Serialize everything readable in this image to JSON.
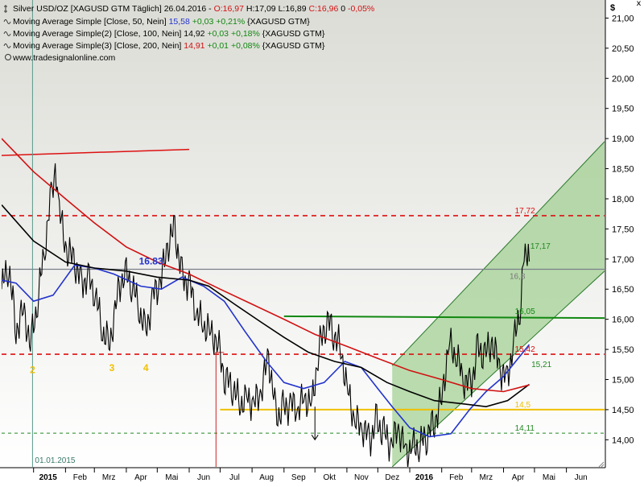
{
  "header": {
    "instrument_name": "Silver USD/OZ [XAGUSD GTM  Täglich]",
    "date": "26.04.2016",
    "ohlc": {
      "open": "O:16,97",
      "high": "H:17,09",
      "low": "L:16,89",
      "close": "C:16,96",
      "change": "0",
      "change_pct": "-0,05%"
    },
    "studies": [
      {
        "name": "Moving Average Simple [Close, 50, Nein]",
        "value": "15,58",
        "change": "+0,03",
        "change_pct": "+0,21%",
        "symbol": "{XAGUSD GTM}",
        "color": "#2233cc"
      },
      {
        "name": "Moving Average Simple(2) [Close, 100, Nein]",
        "value": "14,92",
        "change": "+0,03",
        "change_pct": "+0,18%",
        "symbol": "{XAGUSD GTM}",
        "color": "#000000"
      },
      {
        "name": "Moving Average Simple(3) [Close, 200, Nein]",
        "value": "14,91",
        "change": "+0,01",
        "change_pct": "+0,08%",
        "symbol": "{XAGUSD GTM}",
        "color": "#d11111"
      }
    ],
    "website": "www.tradesignalonline.com",
    "close_glyph": "x"
  },
  "colors": {
    "background_top": "#dcdcd6",
    "background_bottom": "#ffffff",
    "price": "#000000",
    "sma50": "#2233cc",
    "sma100": "#000000",
    "sma200": "#d11111",
    "resistance_dash": "#dd1111",
    "support_green_dash": "#228822",
    "yellow_line": "#f0c000",
    "green_line": "#118811",
    "channel_fill": "#9ecf8e",
    "channel_line": "#2a7a2a",
    "wave_label": "#f0c000",
    "blue_text": "#2233cc",
    "red_vertical": "#cc2222"
  },
  "chart_data": {
    "type": "line",
    "title": "Silver USD/OZ [XAGUSD GTM  Täglich]",
    "currency_label": "$",
    "ylim": [
      13.55,
      21.3
    ],
    "y_ticks": [
      "21,00",
      "20,50",
      "20,00",
      "19,50",
      "19,00",
      "18,50",
      "18,00",
      "17,50",
      "17,00",
      "16,50",
      "16,00",
      "15,50",
      "15,00",
      "14,50",
      "14,00"
    ],
    "y_tick_values": [
      21.0,
      20.5,
      20.0,
      19.5,
      19.0,
      18.5,
      18.0,
      17.5,
      17.0,
      16.5,
      16.0,
      15.5,
      15.0,
      14.5,
      14.0
    ],
    "x_date_range": [
      "2014-12-01",
      "2016-07-08"
    ],
    "month_labels": [
      {
        "date": "2015-01-01",
        "label": "2015",
        "bold": true
      },
      {
        "date": "2015-02-01",
        "label": "Feb"
      },
      {
        "date": "2015-03-01",
        "label": "Mrz"
      },
      {
        "date": "2015-04-01",
        "label": "Apr"
      },
      {
        "date": "2015-05-01",
        "label": "Mai"
      },
      {
        "date": "2015-06-01",
        "label": "Jun"
      },
      {
        "date": "2015-07-01",
        "label": "Jul"
      },
      {
        "date": "2015-08-01",
        "label": "Aug"
      },
      {
        "date": "2015-09-01",
        "label": "Sep"
      },
      {
        "date": "2015-10-01",
        "label": "Okt"
      },
      {
        "date": "2015-11-01",
        "label": "Nov"
      },
      {
        "date": "2015-12-01",
        "label": "Dez"
      },
      {
        "date": "2016-01-01",
        "label": "2016",
        "bold": true
      },
      {
        "date": "2016-02-01",
        "label": "Feb"
      },
      {
        "date": "2016-03-01",
        "label": "Mrz"
      },
      {
        "date": "2016-04-01",
        "label": "Apr"
      },
      {
        "date": "2016-05-01",
        "label": "Mai"
      },
      {
        "date": "2016-06-01",
        "label": "Jun"
      }
    ],
    "series": [
      {
        "name": "Silver USD/OZ",
        "kind": "price",
        "points": [
          [
            "2014-12-01",
            16.5
          ],
          [
            "2014-12-08",
            16.9
          ],
          [
            "2014-12-15",
            15.8
          ],
          [
            "2014-12-22",
            16.2
          ],
          [
            "2014-12-29",
            15.6
          ],
          [
            "2015-01-05",
            16.3
          ],
          [
            "2015-01-12",
            17.2
          ],
          [
            "2015-01-19",
            18.2
          ],
          [
            "2015-01-22",
            18.4
          ],
          [
            "2015-01-26",
            17.8
          ],
          [
            "2015-02-02",
            17.1
          ],
          [
            "2015-02-09",
            17.0
          ],
          [
            "2015-02-16",
            16.6
          ],
          [
            "2015-02-23",
            16.7
          ],
          [
            "2015-03-02",
            16.4
          ],
          [
            "2015-03-09",
            15.8
          ],
          [
            "2015-03-16",
            15.6
          ],
          [
            "2015-03-23",
            16.4
          ],
          [
            "2015-03-30",
            16.8
          ],
          [
            "2015-04-06",
            16.6
          ],
          [
            "2015-04-13",
            16.2
          ],
          [
            "2015-04-20",
            15.8
          ],
          [
            "2015-04-27",
            16.4
          ],
          [
            "2015-05-04",
            16.6
          ],
          [
            "2015-05-11",
            17.2
          ],
          [
            "2015-05-18",
            17.5
          ],
          [
            "2015-05-25",
            16.7
          ],
          [
            "2015-06-01",
            16.6
          ],
          [
            "2015-06-08",
            16.1
          ],
          [
            "2015-06-15",
            15.9
          ],
          [
            "2015-06-22",
            15.8
          ],
          [
            "2015-06-29",
            15.6
          ],
          [
            "2015-07-06",
            15.0
          ],
          [
            "2015-07-13",
            14.9
          ],
          [
            "2015-07-20",
            14.6
          ],
          [
            "2015-07-27",
            14.7
          ],
          [
            "2015-08-03",
            14.6
          ],
          [
            "2015-08-10",
            14.8
          ],
          [
            "2015-08-17",
            15.4
          ],
          [
            "2015-08-24",
            14.4
          ],
          [
            "2015-08-31",
            14.5
          ],
          [
            "2015-09-07",
            14.6
          ],
          [
            "2015-09-14",
            14.5
          ],
          [
            "2015-09-21",
            14.7
          ],
          [
            "2015-09-28",
            14.6
          ],
          [
            "2015-10-05",
            15.5
          ],
          [
            "2015-10-12",
            16.0
          ],
          [
            "2015-10-19",
            15.8
          ],
          [
            "2015-10-26",
            15.5
          ],
          [
            "2015-11-02",
            14.8
          ],
          [
            "2015-11-09",
            14.3
          ],
          [
            "2015-11-16",
            14.2
          ],
          [
            "2015-11-23",
            14.0
          ],
          [
            "2015-11-30",
            14.3
          ],
          [
            "2015-12-07",
            14.1
          ],
          [
            "2015-12-14",
            13.9
          ],
          [
            "2015-12-21",
            14.2
          ],
          [
            "2015-12-28",
            13.8
          ],
          [
            "2016-01-04",
            13.9
          ],
          [
            "2016-01-11",
            13.9
          ],
          [
            "2016-01-18",
            14.1
          ],
          [
            "2016-01-25",
            14.3
          ],
          [
            "2016-02-01",
            14.7
          ],
          [
            "2016-02-08",
            15.6
          ],
          [
            "2016-02-15",
            15.4
          ],
          [
            "2016-02-22",
            15.0
          ],
          [
            "2016-02-29",
            14.9
          ],
          [
            "2016-03-07",
            15.5
          ],
          [
            "2016-03-14",
            15.4
          ],
          [
            "2016-03-21",
            15.6
          ],
          [
            "2016-03-28",
            15.2
          ],
          [
            "2016-04-04",
            15.0
          ],
          [
            "2016-04-11",
            15.6
          ],
          [
            "2016-04-18",
            16.3
          ],
          [
            "2016-04-21",
            17.2
          ],
          [
            "2016-04-26",
            16.96
          ]
        ]
      },
      {
        "name": "Moving Average Simple [Close, 50, Nein]",
        "kind": "sma50",
        "points": [
          [
            "2014-12-01",
            16.65
          ],
          [
            "2014-12-15",
            16.6
          ],
          [
            "2015-01-01",
            16.3
          ],
          [
            "2015-01-20",
            16.4
          ],
          [
            "2015-02-10",
            16.9
          ],
          [
            "2015-03-01",
            16.85
          ],
          [
            "2015-03-20",
            16.75
          ],
          [
            "2015-04-15",
            16.55
          ],
          [
            "2015-05-05",
            16.5
          ],
          [
            "2015-05-25",
            16.7
          ],
          [
            "2015-06-15",
            16.55
          ],
          [
            "2015-07-05",
            16.3
          ],
          [
            "2015-07-25",
            15.8
          ],
          [
            "2015-08-15",
            15.3
          ],
          [
            "2015-09-01",
            14.95
          ],
          [
            "2015-09-20",
            14.85
          ],
          [
            "2015-10-10",
            14.95
          ],
          [
            "2015-10-30",
            15.3
          ],
          [
            "2015-11-15",
            15.2
          ],
          [
            "2015-12-01",
            14.85
          ],
          [
            "2015-12-15",
            14.55
          ],
          [
            "2016-01-01",
            14.2
          ],
          [
            "2016-01-20",
            14.05
          ],
          [
            "2016-02-10",
            14.1
          ],
          [
            "2016-02-28",
            14.5
          ],
          [
            "2016-03-15",
            14.8
          ],
          [
            "2016-04-01",
            15.05
          ],
          [
            "2016-04-26",
            15.58
          ]
        ]
      },
      {
        "name": "Moving Average Simple(2) [Close, 100, Nein]",
        "kind": "sma100",
        "points": [
          [
            "2014-12-01",
            17.9
          ],
          [
            "2015-01-01",
            17.3
          ],
          [
            "2015-02-01",
            16.95
          ],
          [
            "2015-03-01",
            16.85
          ],
          [
            "2015-04-01",
            16.8
          ],
          [
            "2015-05-01",
            16.7
          ],
          [
            "2015-06-01",
            16.65
          ],
          [
            "2015-06-20",
            16.55
          ],
          [
            "2015-07-15",
            16.25
          ],
          [
            "2015-08-10",
            15.95
          ],
          [
            "2015-09-01",
            15.7
          ],
          [
            "2015-09-25",
            15.45
          ],
          [
            "2015-10-20",
            15.3
          ],
          [
            "2015-11-15",
            15.2
          ],
          [
            "2015-12-10",
            14.95
          ],
          [
            "2016-01-01",
            14.8
          ],
          [
            "2016-01-25",
            14.65
          ],
          [
            "2016-02-20",
            14.6
          ],
          [
            "2016-03-15",
            14.55
          ],
          [
            "2016-04-05",
            14.65
          ],
          [
            "2016-04-26",
            14.92
          ]
        ]
      },
      {
        "name": "Moving Average Simple(3) [Close, 200, Nein]",
        "kind": "sma200",
        "points": [
          [
            "2014-12-01",
            19.0
          ],
          [
            "2015-01-01",
            18.45
          ],
          [
            "2015-02-01",
            18.0
          ],
          [
            "2015-03-01",
            17.6
          ],
          [
            "2015-04-01",
            17.2
          ],
          [
            "2015-05-01",
            16.95
          ],
          [
            "2015-06-01",
            16.75
          ],
          [
            "2015-07-01",
            16.5
          ],
          [
            "2015-08-01",
            16.25
          ],
          [
            "2015-09-01",
            16.0
          ],
          [
            "2015-10-01",
            15.75
          ],
          [
            "2015-11-01",
            15.55
          ],
          [
            "2015-12-01",
            15.35
          ],
          [
            "2016-01-01",
            15.15
          ],
          [
            "2016-02-01",
            15.0
          ],
          [
            "2016-03-01",
            14.85
          ],
          [
            "2016-04-01",
            14.8
          ],
          [
            "2016-04-26",
            14.91
          ]
        ]
      }
    ],
    "horizontal_lines": [
      {
        "kind": "resistance_dash",
        "value": 17.72,
        "label": "17,72"
      },
      {
        "kind": "resistance_dash",
        "value": 15.42,
        "label": "15,42"
      },
      {
        "kind": "support_green_dash",
        "value": 14.11,
        "label": "14,11"
      },
      {
        "kind": "yellow_line",
        "value": 14.5,
        "start": "2015-07-01",
        "label": "14,5"
      },
      {
        "kind": "gray_line",
        "value": 16.83,
        "start": "2014-12-01",
        "label": "16.83",
        "label_date": "2015-04-25",
        "right_label": "16,8"
      },
      {
        "kind": "green_line",
        "value": 16.05,
        "start": "2015-09-01",
        "end_value": 16.02,
        "label": "16,05"
      },
      {
        "kind": "red_solid_trend",
        "value": 18.72,
        "end_value": 18.82,
        "start": "2014-12-01",
        "end": "2015-06-01"
      }
    ],
    "trend_channel": {
      "start": "2015-12-15",
      "end": "2016-07-08",
      "lower_start": 13.55,
      "lower_end": 16.8,
      "upper_start": 15.23,
      "upper_end": 18.95
    },
    "annotations": [
      {
        "text": "17,17",
        "date": "2016-04-27",
        "value": 17.17,
        "color": "#228822"
      },
      {
        "text": "15,21",
        "date": "2016-04-28",
        "value": 15.21,
        "color": "#228822"
      },
      {
        "text": "2",
        "date": "2014-12-31",
        "value": 15.11,
        "color": "#f0c000",
        "wave": true
      },
      {
        "text": "3",
        "date": "2015-03-18",
        "value": 15.14,
        "color": "#f0c000",
        "wave": true
      },
      {
        "text": "4",
        "date": "2015-04-20",
        "value": 15.14,
        "color": "#f0c000",
        "wave": true
      }
    ],
    "markers": {
      "start_line_date": "2014-12-31",
      "start_line_label": "01.01.2015",
      "red_vertical_date": "2015-06-27",
      "red_vertical_top": 15.45,
      "arrow_date": "2015-10-01"
    }
  }
}
